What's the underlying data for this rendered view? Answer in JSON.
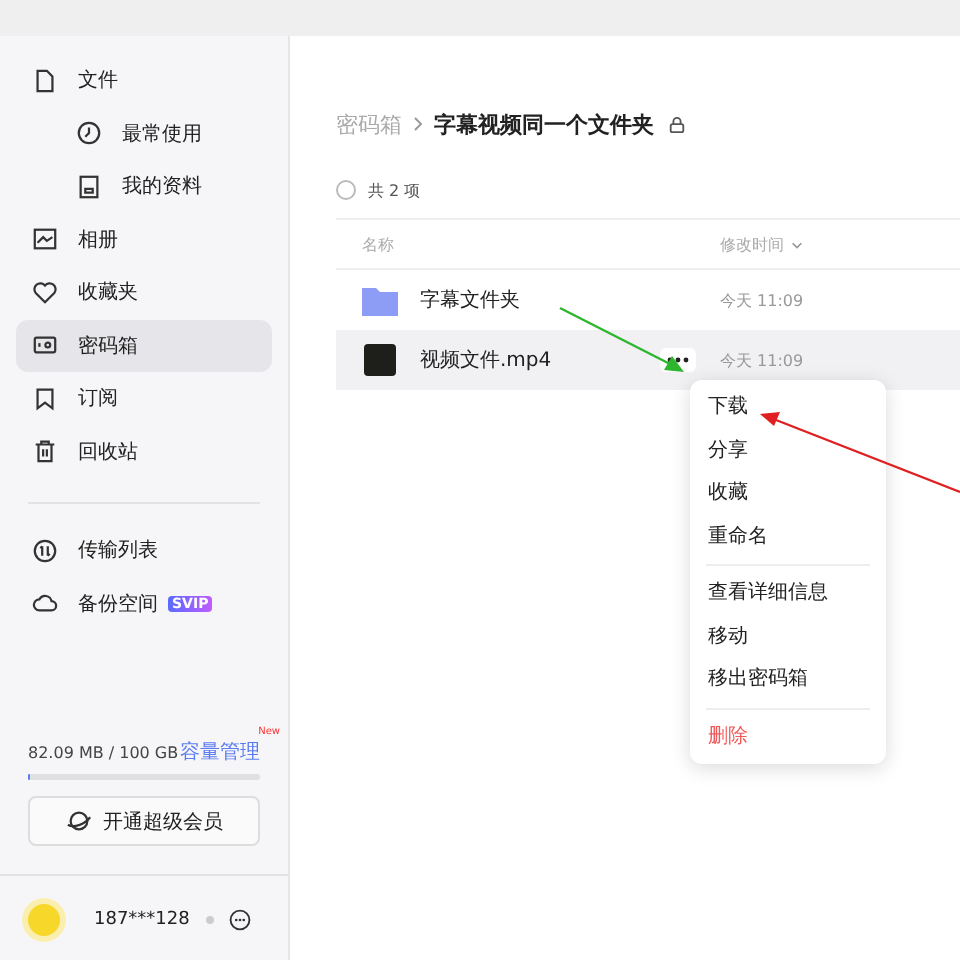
{
  "sidebar": {
    "items": [
      {
        "label": "文件",
        "selected": false,
        "children": [
          {
            "label": "最常使用",
            "selected": false
          },
          {
            "label": "我的资料",
            "selected": false
          }
        ]
      },
      {
        "label": "相册",
        "selected": false
      },
      {
        "label": "收藏夹",
        "selected": false
      },
      {
        "label": "密码箱",
        "selected": true
      },
      {
        "label": "订阅",
        "selected": false
      },
      {
        "label": "回收站",
        "selected": false
      }
    ],
    "secondary_items": [
      {
        "label": "传输列表"
      },
      {
        "label": "备份空间",
        "badge": "SVIP"
      }
    ],
    "storage": {
      "usage": "82.09 MB / 100 GB",
      "manage_link": "容量管理",
      "new_badge": "New",
      "level": 0.01
    },
    "upgrade_button": "开通超级会员",
    "user": {
      "name": "187***128"
    }
  },
  "breadcrumb": {
    "parent": "密码箱",
    "current": "字幕视频同一个文件夹"
  },
  "item_count": "共 2 项",
  "select_all": {
    "checked": false
  },
  "table": {
    "columns": [
      "名称",
      "修改时间"
    ],
    "rows": [
      {
        "kind": "folder",
        "name": "字幕文件夹",
        "modified": "今天 11:09",
        "selected": false
      },
      {
        "kind": "video",
        "name": "视频文件.mp4",
        "modified": "今天 11:09",
        "selected": true
      }
    ]
  },
  "context_menu": {
    "groups": [
      [
        {
          "label": "下载",
          "kind": "normal"
        },
        {
          "label": "分享",
          "kind": "normal"
        },
        {
          "label": "收藏",
          "kind": "normal"
        },
        {
          "label": "重命名",
          "kind": "normal"
        }
      ],
      [
        {
          "label": "查看详细信息",
          "kind": "normal"
        },
        {
          "label": "移动",
          "kind": "normal"
        },
        {
          "label": "移出密码箱",
          "kind": "normal"
        }
      ],
      [
        {
          "label": "删除",
          "kind": "danger"
        }
      ]
    ]
  }
}
